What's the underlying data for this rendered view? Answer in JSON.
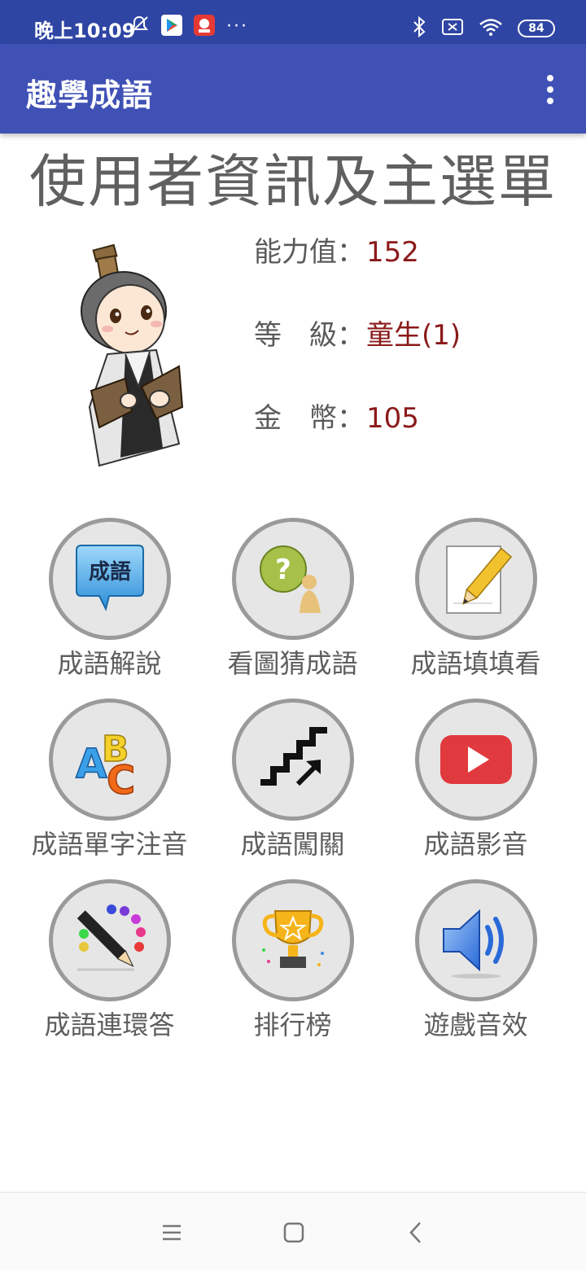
{
  "status_bar": {
    "time": "晚上10:09",
    "dots": "···",
    "battery": "84",
    "icons": [
      "mute-icon",
      "play-store-icon",
      "app-notification-icon",
      "bluetooth-icon",
      "sim-icon",
      "wifi-icon",
      "battery-icon"
    ]
  },
  "app_bar": {
    "title": "趣學成語",
    "menu_icon": "more-vert-icon"
  },
  "page": {
    "title": "使用者資訊及主選單"
  },
  "stats": [
    {
      "label": "能力值：",
      "value": "152"
    },
    {
      "label": "等　級：",
      "value": "童生(1)"
    },
    {
      "label": "金　幣：",
      "value": "105"
    }
  ],
  "menu": [
    {
      "label": "成語解說",
      "icon": "idiom-speech-icon"
    },
    {
      "label": "看圖猜成語",
      "icon": "question-person-icon"
    },
    {
      "label": "成語填填看",
      "icon": "pencil-paper-icon"
    },
    {
      "label": "成語單字注音",
      "icon": "abc-icon"
    },
    {
      "label": "成語闖關",
      "icon": "stairs-icon"
    },
    {
      "label": "成語影音",
      "icon": "video-play-icon"
    },
    {
      "label": "成語連環答",
      "icon": "pen-dots-icon"
    },
    {
      "label": "排行榜",
      "icon": "trophy-icon"
    },
    {
      "label": "遊戲音效",
      "icon": "speaker-icon"
    }
  ],
  "icon_badge_text": "成語",
  "colors": {
    "status_bar": "#2f45a4",
    "app_bar": "#3f51b5",
    "value_text": "#8b1a1a",
    "label_text": "#5e5e5e",
    "circle_bg": "#e6e6e6",
    "circle_border": "#9a9a9a"
  }
}
